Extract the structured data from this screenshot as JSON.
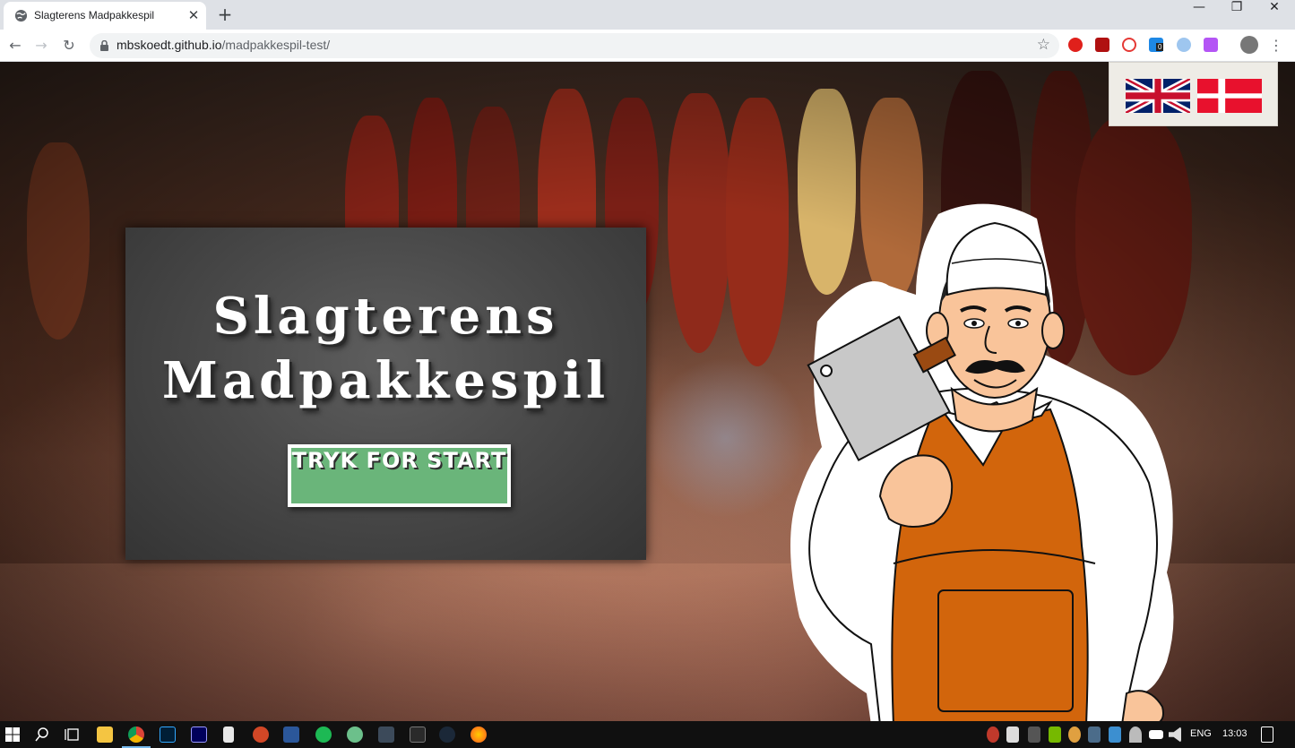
{
  "browser": {
    "tab": {
      "title": "Slagterens Madpakkespil",
      "close": "✕"
    },
    "new_tab": "+",
    "window": {
      "minimize": "—",
      "restore": "❐",
      "close": "✕"
    },
    "nav": {
      "back": "←",
      "forward": "→",
      "reload": "↻",
      "menu": "⋮"
    },
    "url": {
      "host": "mbskoedt.github.io",
      "path": "/madpakkespil-test/"
    },
    "bookmark": "☆",
    "extension_count": "0"
  },
  "page": {
    "title_line1": "Slagterens",
    "title_line2": "Madpakkespil",
    "start_button": "TRYK FOR START",
    "languages": [
      "English",
      "Dansk"
    ],
    "colors": {
      "button": "#6ab57a",
      "apron": "#d2650c",
      "chalkboard": "#4a4a4a"
    }
  },
  "taskbar": {
    "language": "ENG",
    "time": "13:03"
  }
}
